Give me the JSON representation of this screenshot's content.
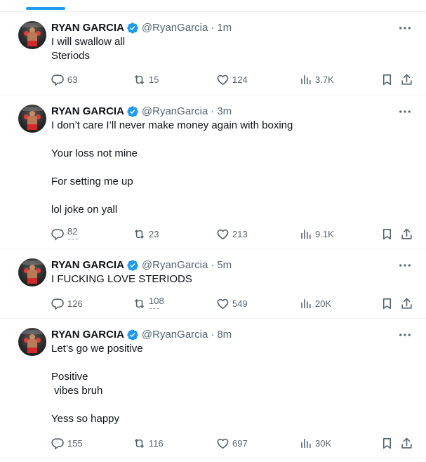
{
  "colors": {
    "accent": "#1d9bf0",
    "text": "#0f1419",
    "secondary": "#536471",
    "divider": "#eff3f4"
  },
  "icons": {
    "verified": "verified-badge-icon",
    "more": "more-icon",
    "reply": "reply-icon",
    "retweet": "retweet-icon",
    "like": "like-icon",
    "views": "views-icon",
    "bookmark": "bookmark-icon",
    "share": "share-icon"
  },
  "tweets": [
    {
      "name": "RYAN GARCIA",
      "handle": "@RyanGarcia",
      "separator": "·",
      "time": "1m",
      "lines": [
        "I will swallow all",
        "Steriods"
      ],
      "replies": "63",
      "retweets": "15",
      "likes": "124",
      "views": "3.7K"
    },
    {
      "name": "RYAN GARCIA",
      "handle": "@RyanGarcia",
      "separator": "·",
      "time": "3m",
      "lines": [
        "I don’t care I’ll never make money again with boxing",
        "",
        "Your loss not mine",
        "",
        "For setting me up",
        "",
        "lol joke on yall"
      ],
      "replies": "82",
      "retweets": "23",
      "likes": "213",
      "views": "9.1K"
    },
    {
      "name": "RYAN GARCIA",
      "handle": "@RyanGarcia",
      "separator": "·",
      "time": "5m",
      "lines": [
        "I FUCKING LOVE STERIODS"
      ],
      "replies": "126",
      "retweets": "108",
      "likes": "549",
      "views": "20K"
    },
    {
      "name": "RYAN GARCIA",
      "handle": "@RyanGarcia",
      "separator": "·",
      "time": "8m",
      "lines": [
        "Let’s go we positive",
        "",
        "Positive",
        " vibes bruh",
        "",
        "Yess so happy"
      ],
      "replies": "155",
      "retweets": "116",
      "likes": "697",
      "views": "30K"
    }
  ]
}
